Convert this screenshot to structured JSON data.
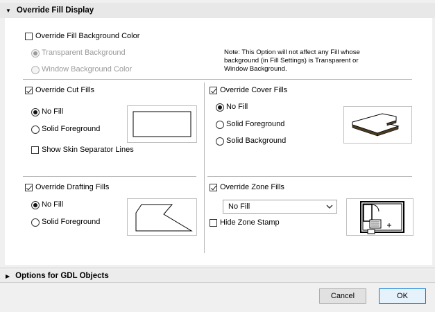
{
  "sections": {
    "override_fill_display": "Override Fill Display",
    "options_gdl": "Options for GDL Objects"
  },
  "background": {
    "override_label": "Override Fill Background Color",
    "override_checked": false,
    "transparent_label": "Transparent Background",
    "window_label": "Window Background Color",
    "note": "Note: This Option will not affect any Fill whose background (in Fill Settings) is Transparent or Window Background."
  },
  "cut_fills": {
    "label": "Override Cut Fills",
    "checked": true,
    "no_fill": "No Fill",
    "solid_foreground": "Solid Foreground",
    "skin_separator": "Show Skin Separator Lines"
  },
  "cover_fills": {
    "label": "Override Cover Fills",
    "checked": true,
    "no_fill": "No Fill",
    "solid_foreground": "Solid Foreground",
    "solid_background": "Solid Background"
  },
  "drafting_fills": {
    "label": "Override Drafting Fills",
    "checked": true,
    "no_fill": "No Fill",
    "solid_foreground": "Solid Foreground"
  },
  "zone_fills": {
    "label": "Override Zone Fills",
    "checked": true,
    "select_value": "No Fill",
    "hide_stamp": "Hide Zone Stamp"
  },
  "buttons": {
    "cancel": "Cancel",
    "ok": "OK"
  },
  "colors": {
    "accent": "#0078d7",
    "cover_fill": "#4a3a22"
  }
}
